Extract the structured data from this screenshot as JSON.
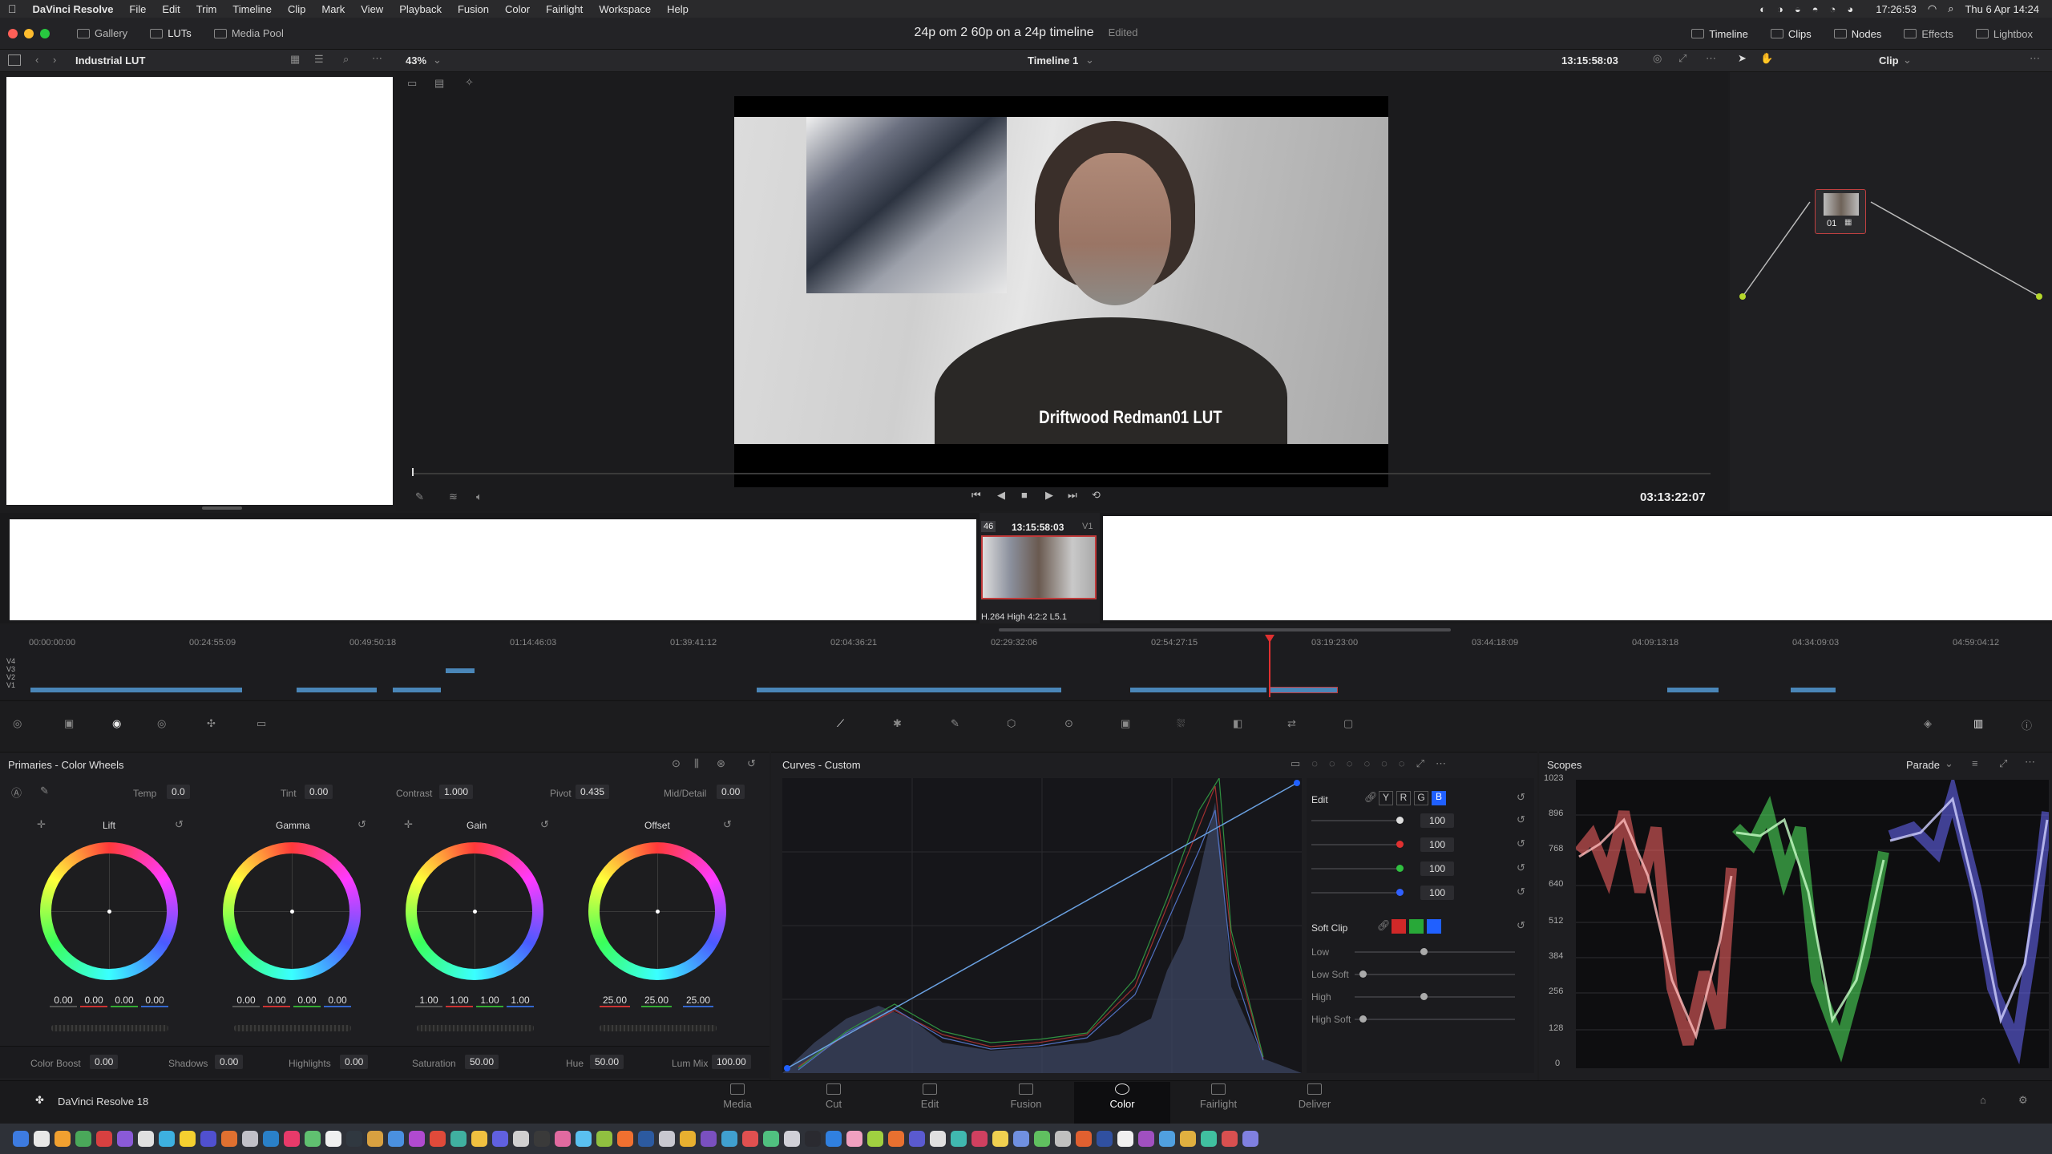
{
  "menubar": {
    "app": "DaVinci Resolve",
    "items": [
      "File",
      "Edit",
      "Trim",
      "Timeline",
      "Clip",
      "Mark",
      "View",
      "Playback",
      "Fusion",
      "Color",
      "Fairlight",
      "Workspace",
      "Help"
    ],
    "clock": "17:26:53",
    "date": "Thu 6 Apr  14:24"
  },
  "titlebar": {
    "gallery": "Gallery",
    "luts": "LUTs",
    "media_pool": "Media Pool",
    "project_title": "24p om 2 60p on a 24p timeline",
    "edited": "Edited",
    "timeline": "Timeline",
    "clips": "Clips",
    "nodes": "Nodes",
    "effects": "Effects",
    "lightbox": "Lightbox"
  },
  "viewerbar": {
    "lut_folder": "Industrial LUT",
    "zoom": "43%",
    "timeline_name": "Timeline 1",
    "timecode": "13:15:58:03",
    "node_mode": "Clip"
  },
  "viewer": {
    "caption": "Driftwood Redman01 LUT",
    "playhead_timecode": "03:13:22:07"
  },
  "clip_strip": {
    "clip_number": "46",
    "clip_timecode": "13:15:58:03",
    "track": "V1",
    "codec": "H.264 High 4:2:2 L5.1"
  },
  "timeline": {
    "ruler": [
      "00:00:00:00",
      "00:24:55:09",
      "00:49:50:18",
      "01:14:46:03",
      "01:39:41:12",
      "02:04:36:21",
      "02:29:32:06",
      "02:54:27:15",
      "03:19:23:00",
      "03:44:18:09",
      "04:09:13:18",
      "04:34:09:03",
      "04:59:04:12"
    ],
    "tracks": [
      "V4",
      "V3",
      "V2",
      "V1"
    ]
  },
  "node": {
    "label": "01"
  },
  "primaries": {
    "title": "Primaries - Color Wheels",
    "temp_label": "Temp",
    "temp": "0.0",
    "tint_label": "Tint",
    "tint": "0.00",
    "contrast_label": "Contrast",
    "contrast": "1.000",
    "pivot_label": "Pivot",
    "pivot": "0.435",
    "middetail_label": "Mid/Detail",
    "middetail": "0.00",
    "wheels": [
      {
        "name": "Lift",
        "values": [
          "0.00",
          "0.00",
          "0.00",
          "0.00"
        ]
      },
      {
        "name": "Gamma",
        "values": [
          "0.00",
          "0.00",
          "0.00",
          "0.00"
        ]
      },
      {
        "name": "Gain",
        "values": [
          "1.00",
          "1.00",
          "1.00",
          "1.00"
        ]
      },
      {
        "name": "Offset",
        "values": [
          "25.00",
          "25.00",
          "25.00"
        ]
      }
    ],
    "colorboost_label": "Color Boost",
    "colorboost": "0.00",
    "shadows_label": "Shadows",
    "shadows": "0.00",
    "highlights_label": "Highlights",
    "highlights": "0.00",
    "saturation_label": "Saturation",
    "saturation": "50.00",
    "hue_label": "Hue",
    "hue": "50.00",
    "lummix_label": "Lum Mix",
    "lummix": "100.00"
  },
  "curves": {
    "title": "Curves - Custom",
    "edit_label": "Edit",
    "channels": [
      "Y",
      "R",
      "G",
      "B"
    ],
    "intensity": [
      "100",
      "100",
      "100",
      "100"
    ],
    "softclip_label": "Soft Clip",
    "low_label": "Low",
    "low_soft_label": "Low Soft",
    "high_label": "High",
    "high_soft_label": "High Soft"
  },
  "scopes": {
    "title": "Scopes",
    "mode": "Parade",
    "scale": [
      "1023",
      "896",
      "768",
      "640",
      "512",
      "384",
      "256",
      "128",
      "0"
    ]
  },
  "pages": {
    "items": [
      "Media",
      "Cut",
      "Edit",
      "Fusion",
      "Color",
      "Fairlight",
      "Deliver"
    ],
    "active": "Color",
    "product": "DaVinci Resolve 18"
  }
}
